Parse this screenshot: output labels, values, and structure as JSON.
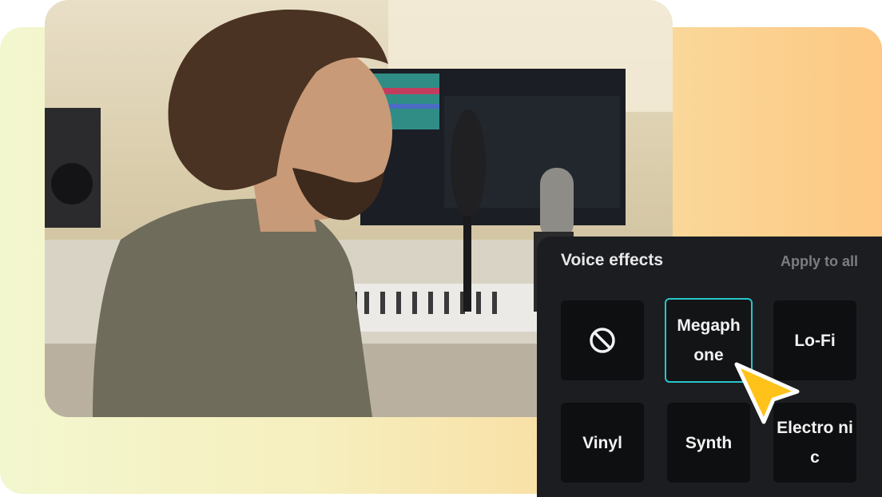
{
  "panel": {
    "title": "Voice effects",
    "apply_all_label": "Apply to all",
    "effects": [
      {
        "label": "",
        "icon": "none-icon",
        "selected": false
      },
      {
        "label": "Megaph one",
        "selected": true
      },
      {
        "label": "Lo-Fi",
        "selected": false
      },
      {
        "label": "Vinyl",
        "selected": false
      },
      {
        "label": "Synth",
        "selected": false
      },
      {
        "label": "Electro nic",
        "selected": false
      }
    ]
  },
  "colors": {
    "panel_bg": "#1c1d20",
    "tile_bg": "#0e0f11",
    "selected_border": "#27c6c8",
    "cursor": "#ffc21a"
  }
}
